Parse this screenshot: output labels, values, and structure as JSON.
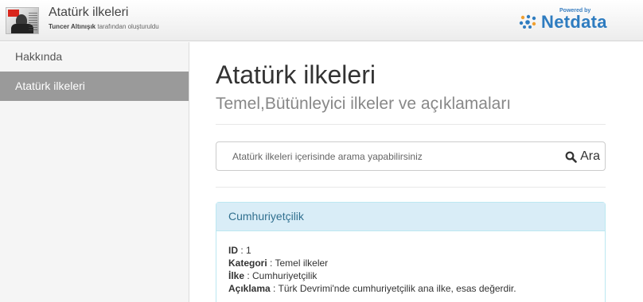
{
  "header": {
    "title": "Atatürk ilkeleri",
    "author": "Tuncer Altınışık",
    "subtitle_rest": "tarafından oluşturuldu",
    "powered_by": "Powered by",
    "brand": "Netdata"
  },
  "sidebar": {
    "items": [
      {
        "label": "Hakkında"
      },
      {
        "label": "Atatürk ilkeleri"
      }
    ]
  },
  "main": {
    "title": "Atatürk ilkeleri",
    "subtitle": "Temel,Bütünleyici ilkeler ve açıklamaları",
    "search": {
      "placeholder": "Atatürk ilkeleri içerisinde arama yapabilirsiniz",
      "button_label": "Ara"
    },
    "panel": {
      "heading": "Cumhuriyetçilik",
      "fields": [
        {
          "label": "ID",
          "value": " : 1"
        },
        {
          "label": "Kategori",
          "value": " : Temel ilkeler"
        },
        {
          "label": "İlke",
          "value": " : Cumhuriyetçilik"
        },
        {
          "label": "Açıklama",
          "value": " : Türk Devrimi'nde cumhuriyetçilik ana ilke, esas değerdir."
        }
      ]
    }
  },
  "colors": {
    "panel_heading_bg": "#d9edf7",
    "panel_heading_text": "#31708f",
    "active_nav_bg": "#9a9a9a",
    "brand_blue": "#2e7cc0"
  }
}
